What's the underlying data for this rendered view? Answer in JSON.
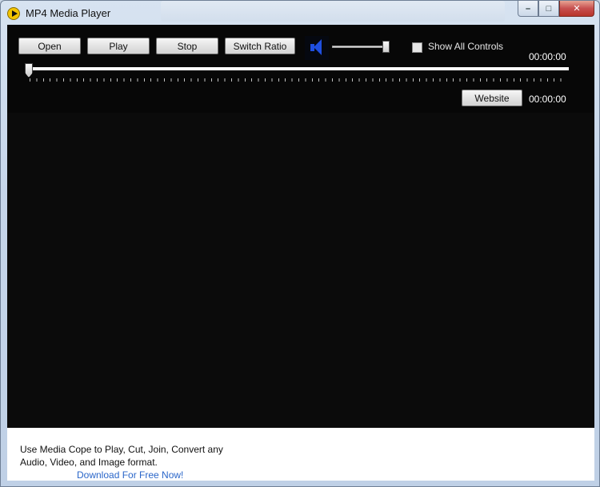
{
  "window": {
    "title": "MP4 Media Player",
    "controls": {
      "minimize": "–",
      "maximize": "□",
      "close": "✕"
    }
  },
  "toolbar": {
    "open_label": "Open",
    "play_label": "Play",
    "stop_label": "Stop",
    "switch_ratio_label": "Switch Ratio",
    "show_all_controls_label": "Show All Controls",
    "show_all_controls_checked": false,
    "time_display": "00:00:00",
    "website_label": "Website",
    "time_display_2": "00:00:00"
  },
  "seek": {
    "position": 0
  },
  "volume": {
    "level": 0.95
  },
  "promo": {
    "line1": "Use Media Cope to Play, Cut, Join, Convert any",
    "line2": "Audio, Video, and Image format.",
    "link_text": "Download For Free Now!"
  },
  "colors": {
    "link": "#2a66c9",
    "speaker_icon": "#1f4fe0",
    "video_bg": "#0b0b0b"
  }
}
